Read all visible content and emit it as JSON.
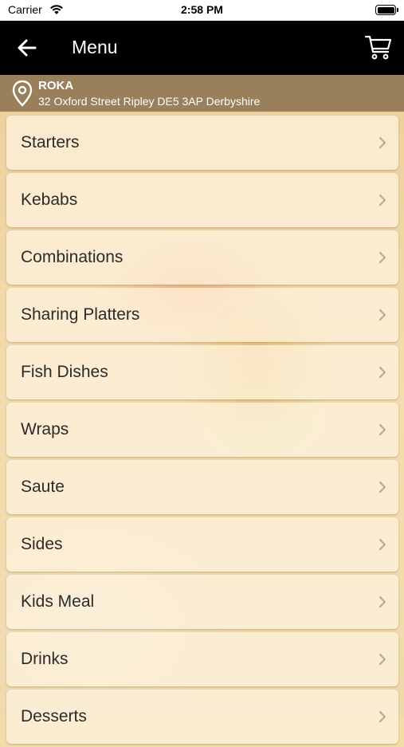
{
  "status_bar": {
    "carrier": "Carrier",
    "time": "2:58 PM"
  },
  "nav": {
    "title": "Menu",
    "back_icon": "back-arrow-icon",
    "cart_icon": "cart-icon"
  },
  "location": {
    "name": "ROKA",
    "address": "32 Oxford Street Ripley DE5 3AP Derbyshire"
  },
  "menu": {
    "items": [
      {
        "label": "Starters"
      },
      {
        "label": "Kebabs"
      },
      {
        "label": "Combinations"
      },
      {
        "label": "Sharing Platters"
      },
      {
        "label": "Fish Dishes"
      },
      {
        "label": "Wraps"
      },
      {
        "label": "Saute"
      },
      {
        "label": "Sides"
      },
      {
        "label": "Kids Meal"
      },
      {
        "label": "Drinks"
      },
      {
        "label": "Desserts"
      }
    ]
  },
  "colors": {
    "nav_background": "#000000",
    "location_bar": "#785f41",
    "item_text": "#2b2b2b",
    "chevron": "#b0a89a"
  }
}
